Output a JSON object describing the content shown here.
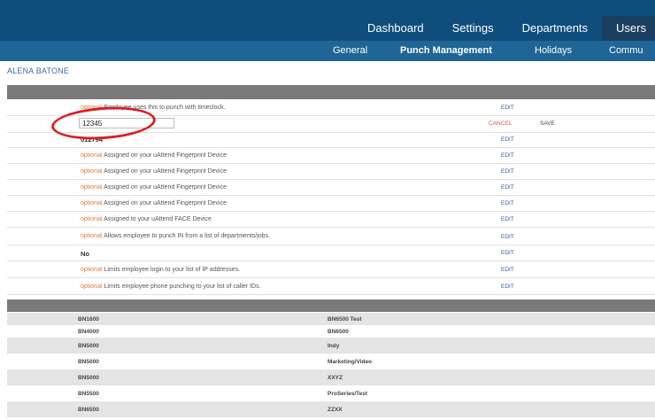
{
  "main_nav": [
    "Dashboard",
    "Settings",
    "Departments",
    "Users"
  ],
  "sub_nav": [
    "General",
    "Punch Management",
    "Holidays",
    "Commu"
  ],
  "user_name": "ALENA BATONE",
  "settings_rows": [
    {
      "prefix": "optional",
      "text": "Employee uses this to punch with timeclock.",
      "action": "EDIT"
    },
    {
      "input_value": "12345",
      "cancel": "CANCEL",
      "save": "SAVE"
    },
    {
      "value": "012794",
      "action": "EDIT"
    },
    {
      "prefix": "optional",
      "text": "Assigned on your uAttend Fingerprint Device",
      "action": "EDIT"
    },
    {
      "prefix": "optional",
      "text": "Assigned on your uAttend Fingerprint Device",
      "action": "EDIT"
    },
    {
      "prefix": "optional",
      "text": "Assigned on your uAttend Fingerprint Device",
      "action": "EDIT"
    },
    {
      "prefix": "optional",
      "text": "Assigned on your uAttend Fingerprint Device",
      "action": "EDIT"
    },
    {
      "prefix": "optional",
      "text": "Assigned to your uAttend FACE Device",
      "action": "EDIT"
    },
    {
      "prefix": "optional",
      "text": "Allows employee to punch IN from a list of departments/jobs.",
      "action": "EDIT"
    },
    {
      "value": "No",
      "action": "EDIT"
    },
    {
      "prefix": "optional",
      "text": "Limits employee login to your list of IP addresses.",
      "action": "EDIT"
    },
    {
      "prefix": "optional",
      "text": "Limits employee phone punching to your list of caller IDs.",
      "action": "EDIT"
    }
  ],
  "device_table": [
    [
      "BN1600",
      "BN6500 Test"
    ],
    [
      "BN4000",
      "BN6500"
    ],
    [
      "BN5000",
      "Indy"
    ],
    [
      "BN5000",
      "Marketing/Video"
    ],
    [
      "BN5000",
      "XXYZ"
    ],
    [
      "BN5500",
      "ProSeries/Test"
    ],
    [
      "BN6500",
      "ZZXX"
    ]
  ]
}
